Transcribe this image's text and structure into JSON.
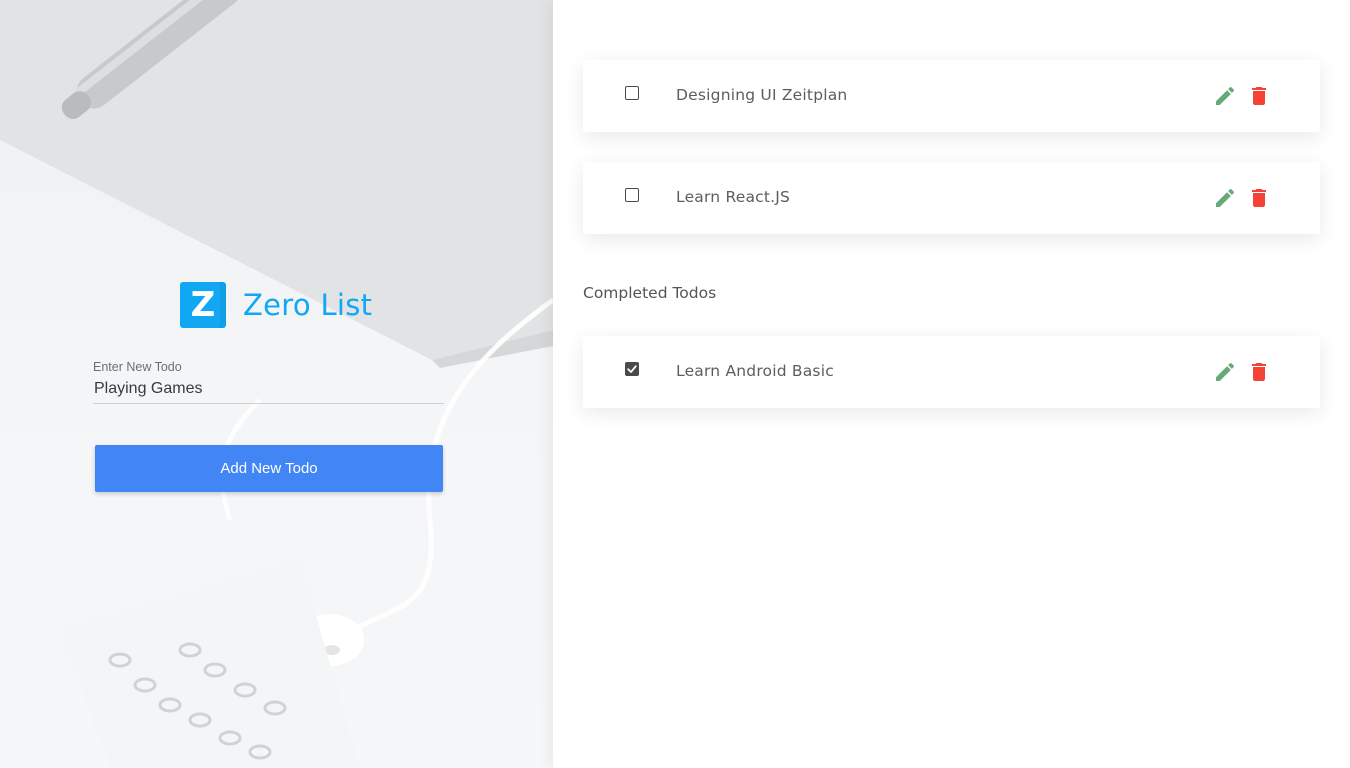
{
  "app": {
    "name": "Zero List",
    "logo_letter": "Z",
    "brand_color": "#11a7f2"
  },
  "form": {
    "label": "Enter New Todo",
    "value": "Playing Games",
    "button_label": "Add New Todo",
    "button_color": "#4285f4"
  },
  "todos": [
    {
      "text": "Designing UI Zeitplan",
      "completed": false
    },
    {
      "text": "Learn React.JS",
      "completed": false
    }
  ],
  "completed_section": {
    "title": "Completed Todos",
    "items": [
      {
        "text": "Learn Android Basic",
        "completed": true
      }
    ]
  },
  "icons": {
    "edit": "pencil-icon",
    "delete": "trash-icon",
    "edit_color": "#66aa77",
    "delete_color": "#f44336"
  }
}
